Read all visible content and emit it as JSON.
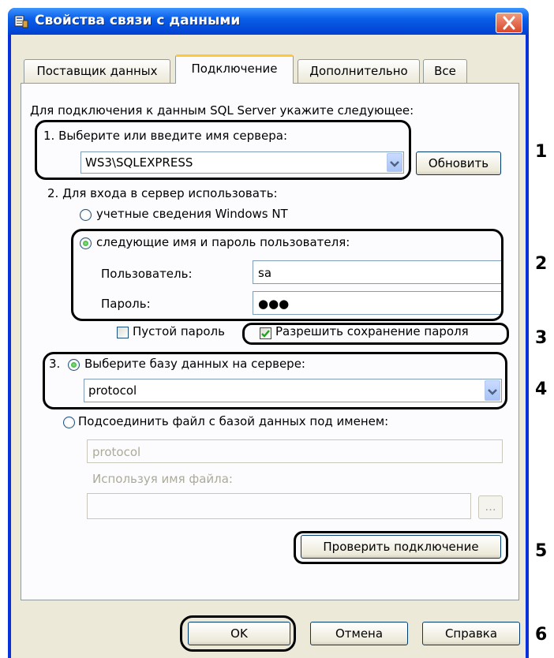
{
  "window": {
    "title": "Свойства связи с данными"
  },
  "tabs": [
    {
      "label": "Поставщик данных"
    },
    {
      "label": "Подключение"
    },
    {
      "label": "Дополнительно"
    },
    {
      "label": "Все"
    }
  ],
  "connection": {
    "intro": "Для подключения к данным SQL Server укажите следующее:",
    "step1_label": "1. Выберите или введите имя сервера:",
    "server_value": "WS3\\SQLEXPRESS",
    "refresh_button": "Обновить",
    "step2_label": "2. Для входа в сервер использовать:",
    "radio_windows_nt": "учетные сведения Windows NT",
    "radio_user_password": "следующие имя и пароль пользователя:",
    "user_label": "Пользователь:",
    "user_value": "sa",
    "password_label": "Пароль:",
    "password_value": "●●●",
    "empty_password_label": "Пустой пароль",
    "allow_save_label": "Разрешить сохранение пароля",
    "step3_label": "3.",
    "radio_select_db": "Выберите базу данных на сервере:",
    "database_value": "protocol",
    "radio_attach_file": "Подсоединить файл с базой данных под именем:",
    "attach_name_value": "protocol",
    "file_name_label": "Используя имя файла:",
    "browse_button": "...",
    "test_connection_button": "Проверить подключение"
  },
  "footer": {
    "ok_button": "OK",
    "cancel_button": "Отмена",
    "help_button": "Справка"
  },
  "annotations": [
    "1",
    "2",
    "3",
    "4",
    "5",
    "6"
  ],
  "colors": {
    "title_bar": "#0a5fe8",
    "dialog_bg": "#ece9d8",
    "tab_highlight": "#ffc83c",
    "close_button": "#d9472b"
  }
}
